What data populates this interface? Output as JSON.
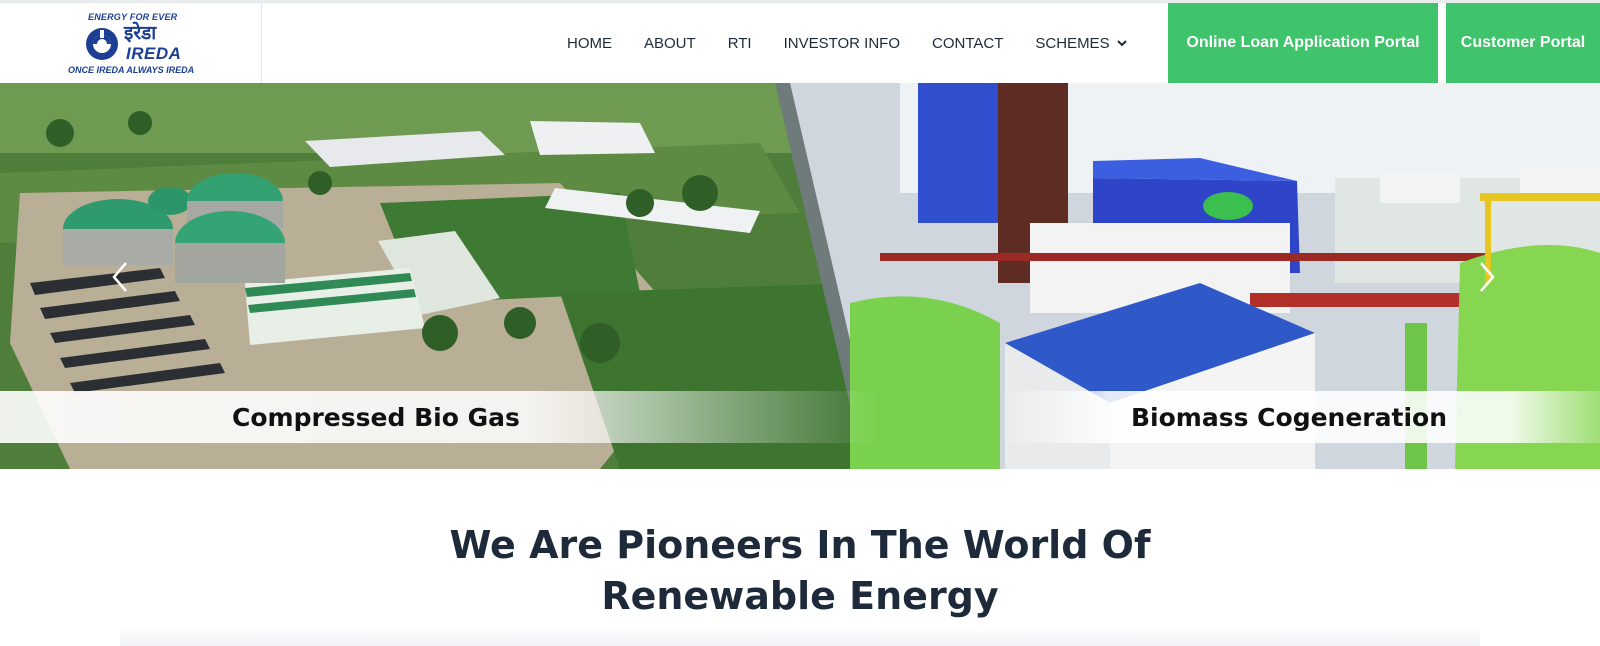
{
  "logo": {
    "tagline_top": "ENERGY FOR EVER",
    "name_hindi": "इरेडा",
    "name": "IREDA",
    "tagline_bottom": "ONCE IREDA ALWAYS IREDA"
  },
  "nav": {
    "items": [
      {
        "label": "HOME"
      },
      {
        "label": "ABOUT"
      },
      {
        "label": "RTI"
      },
      {
        "label": "INVESTOR INFO"
      },
      {
        "label": "CONTACT"
      },
      {
        "label": "SCHEMES",
        "has_dropdown": true
      }
    ]
  },
  "buttons": {
    "loan_portal": "Online Loan Application Portal",
    "customer_portal": "Customer Portal"
  },
  "hero": {
    "slides": [
      {
        "caption": "Compressed Bio Gas"
      },
      {
        "caption": "Biomass Cogeneration"
      }
    ],
    "prev_icon": "chevron-left-icon",
    "next_icon": "chevron-right-icon"
  },
  "intro": {
    "headline_line1": "We Are Pioneers In The World Of",
    "headline_line2": "Renewable Energy"
  },
  "colors": {
    "accent_green": "#3fc36b",
    "brand_blue": "#1d3f93",
    "text_dark": "#1e2a3a"
  }
}
